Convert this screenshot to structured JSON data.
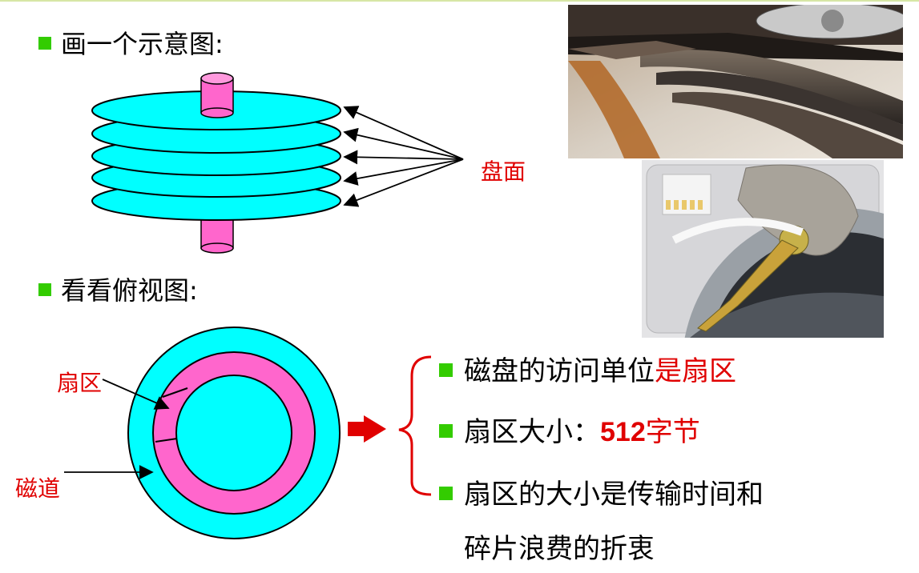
{
  "headings": {
    "side_view": "画一个示意图:",
    "top_view": "看看俯视图:"
  },
  "labels": {
    "platter": "盘面",
    "sector": "扇区",
    "track": "磁道"
  },
  "points": {
    "p1_plain": "磁盘的访问单位",
    "p1_red": "是扇区",
    "p2_plain": "扇区大小：",
    "p2_number": "512",
    "p2_red": "字节",
    "p3_line1": "扇区的大小是传输时间和",
    "p3_line2": "碎片浪费的折衷"
  },
  "colors": {
    "bullet": "#33cc00",
    "platter_fill": "#00ffff",
    "spindle_fill": "#ff66cc",
    "sector_ring": "#ff66cc",
    "accent_red": "#e00000"
  },
  "icons": {
    "arrow": "right-arrow-icon",
    "brace": "left-curly-brace-icon"
  }
}
